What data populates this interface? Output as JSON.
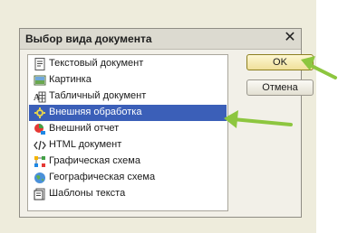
{
  "dialog": {
    "title": "Выбор вида документа",
    "close_glyph": "✕"
  },
  "list": {
    "items": [
      {
        "label": "Текстовый документ",
        "icon": "text-document-icon"
      },
      {
        "label": "Картинка",
        "icon": "picture-icon"
      },
      {
        "label": "Табличный документ",
        "icon": "spreadsheet-icon"
      },
      {
        "label": "Внешняя обработка",
        "icon": "external-processing-icon",
        "selected": true
      },
      {
        "label": "Внешний отчет",
        "icon": "external-report-icon"
      },
      {
        "label": "HTML документ",
        "icon": "html-document-icon"
      },
      {
        "label": "Графическая схема",
        "icon": "graphic-schema-icon"
      },
      {
        "label": "Географическая схема",
        "icon": "geographic-schema-icon"
      },
      {
        "label": "Шаблоны текста",
        "icon": "text-templates-icon"
      }
    ]
  },
  "buttons": {
    "ok_label": "OK",
    "cancel_label": "Отмена"
  },
  "colors": {
    "selection": "#3b5fb8",
    "arrow": "#8dc63f"
  }
}
